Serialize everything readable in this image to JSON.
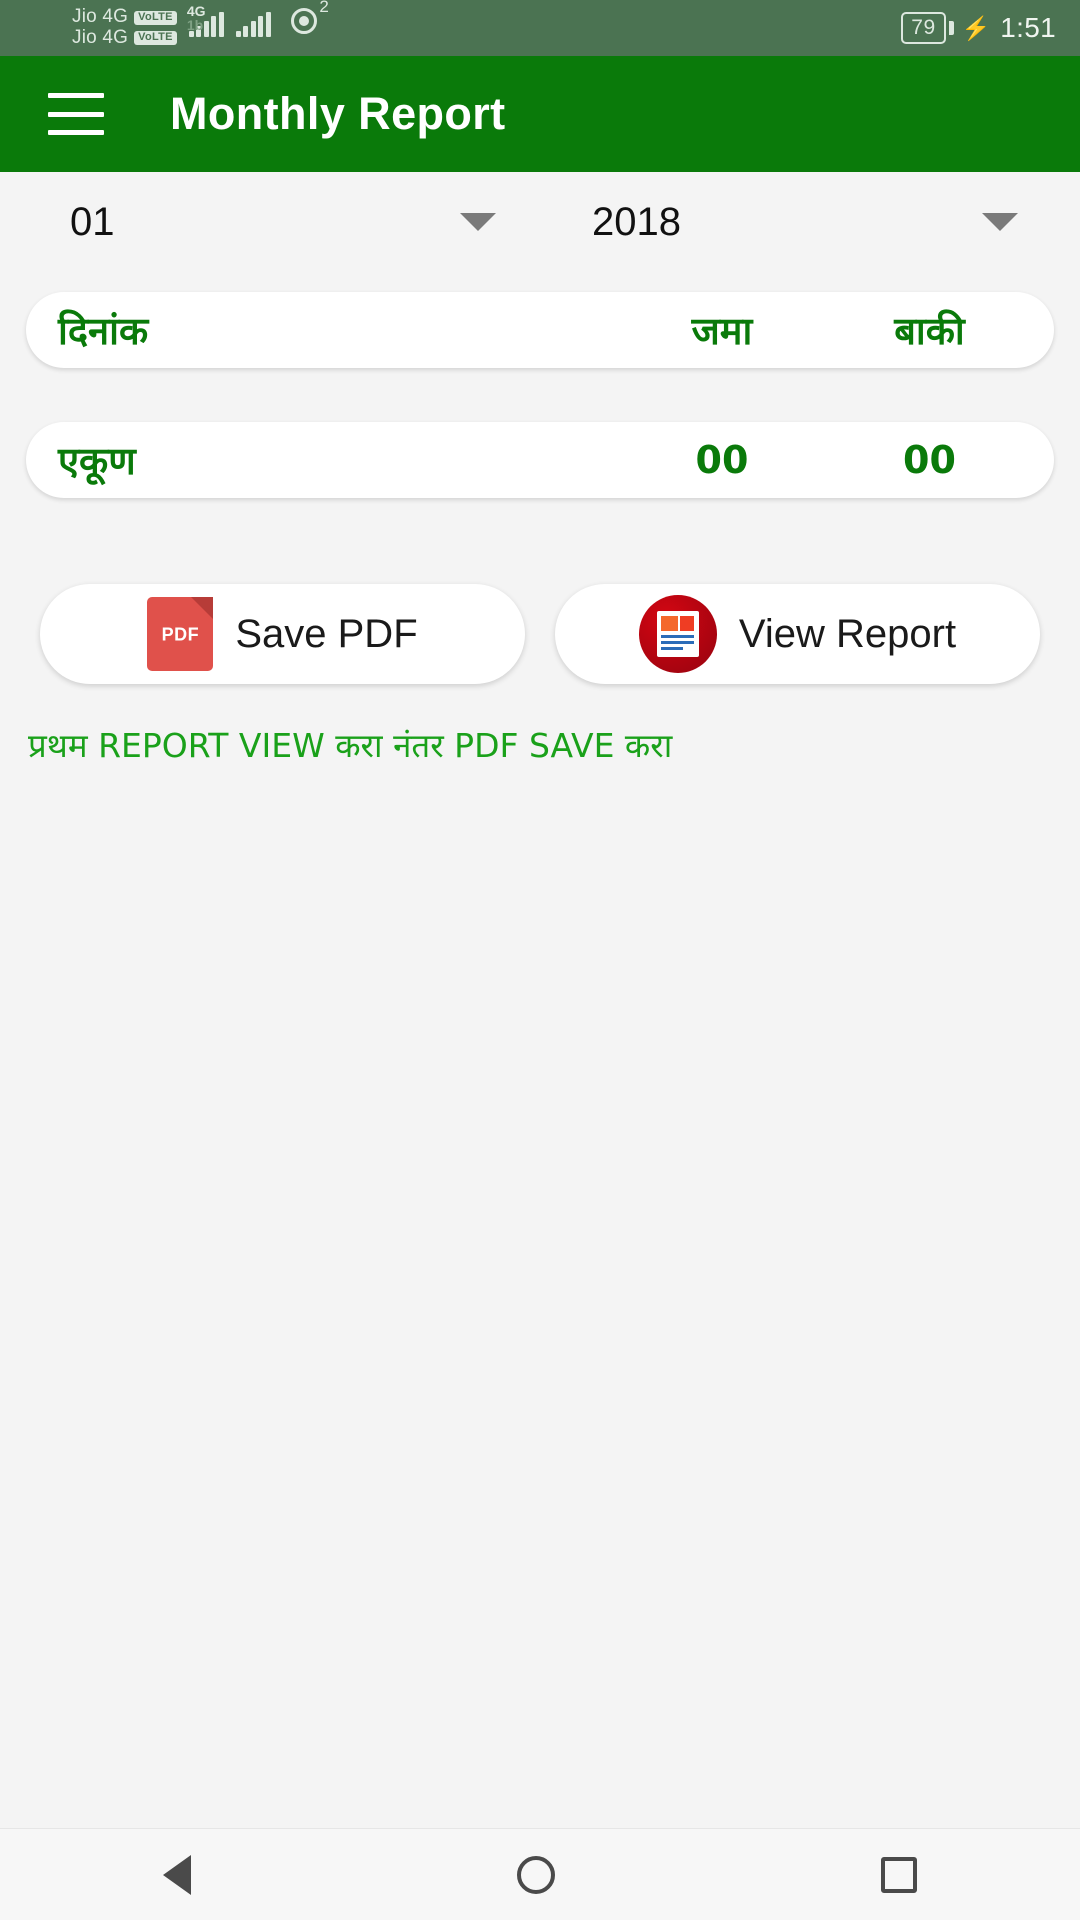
{
  "status_bar": {
    "sim1_label": "Jio 4G",
    "sim1_volte": "VoLTE",
    "sim2_label": "Jio 4G",
    "sim2_volte": "VoLTE",
    "network_type_1": "4G",
    "network_type_2": "1b",
    "wifi_sup": "2",
    "battery_percent": "79",
    "charging_icon": "bolt-icon",
    "time": "1:51"
  },
  "app_bar": {
    "menu_icon": "hamburger-menu-icon",
    "title": "Monthly Report"
  },
  "selectors": {
    "month": {
      "value": "01",
      "caret_icon": "chevron-down-icon"
    },
    "year": {
      "value": "2018",
      "caret_icon": "chevron-down-icon"
    }
  },
  "table": {
    "header": {
      "date": "दिनांक",
      "deposit": "जमा",
      "balance": "बाकी"
    },
    "total_row": {
      "label": "एकूण",
      "deposit": "00",
      "balance": "00"
    }
  },
  "actions": {
    "save_pdf": {
      "label": "Save PDF",
      "icon": "pdf-file-icon",
      "icon_text": "PDF"
    },
    "view_report": {
      "label": "View Report",
      "icon": "report-document-icon"
    }
  },
  "hint": "प्रथम REPORT VIEW करा नंतर PDF SAVE करा",
  "nav_bar": {
    "back_icon": "back-triangle-icon",
    "home_icon": "home-circle-icon",
    "recents_icon": "recents-square-icon"
  },
  "colors": {
    "app_bar_green": "#0a7a0a",
    "status_bar_green": "#4b7352",
    "text_green": "#0a7a0a",
    "hint_green": "#1aa11a",
    "pdf_red": "#e0514b",
    "report_red": "#a50410"
  }
}
